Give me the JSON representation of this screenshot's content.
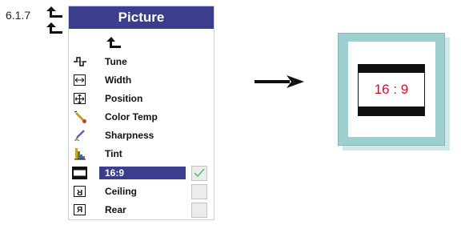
{
  "section": {
    "number": "6.1.7"
  },
  "menu": {
    "title": "Picture",
    "items": [
      {
        "label": "Tune",
        "icon": "tune-icon"
      },
      {
        "label": "Width",
        "icon": "width-icon"
      },
      {
        "label": "Position",
        "icon": "position-icon"
      },
      {
        "label": "Color Temp",
        "icon": "color-temp-icon"
      },
      {
        "label": "Sharpness",
        "icon": "sharpness-icon"
      },
      {
        "label": "Tint",
        "icon": "tint-icon"
      },
      {
        "label": "16:9",
        "icon": "widescreen-icon",
        "selected": true,
        "checked": true
      },
      {
        "label": "Ceiling",
        "icon": "ceiling-icon",
        "checked": false
      },
      {
        "label": "Rear",
        "icon": "rear-icon",
        "checked": false
      }
    ]
  },
  "display": {
    "aspect_text": "16 : 9"
  },
  "colors": {
    "menu_header": "#3b3e8c",
    "aspect_text": "#d4102a",
    "frame": "#9ccfd0",
    "checkmark": "#5cc06a"
  }
}
